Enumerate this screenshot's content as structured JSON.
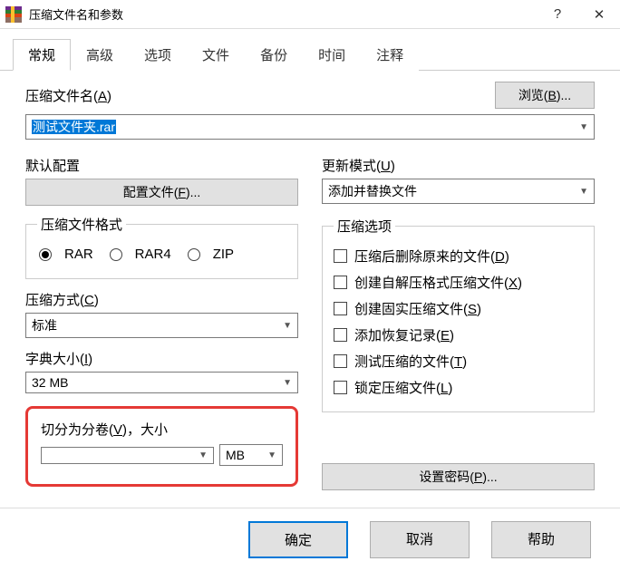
{
  "window": {
    "title": "压缩文件名和参数",
    "help_glyph": "?",
    "close_glyph": "✕"
  },
  "tabs": [
    "常规",
    "高级",
    "选项",
    "文件",
    "备份",
    "时间",
    "注释"
  ],
  "archive_name": {
    "label_pre": "压缩文件名(",
    "label_u": "A",
    "label_post": ")",
    "browse_pre": "浏览(",
    "browse_u": "B",
    "browse_post": ")...",
    "value": "测试文件夹.rar"
  },
  "default_profile": {
    "label": "默认配置",
    "button_pre": "配置文件(",
    "button_u": "F",
    "button_post": ")..."
  },
  "update_mode": {
    "label_pre": "更新模式(",
    "label_u": "U",
    "label_post": ")",
    "value": "添加并替换文件"
  },
  "format": {
    "legend": "压缩文件格式",
    "options": [
      "RAR",
      "RAR4",
      "ZIP"
    ],
    "selected": "RAR"
  },
  "method": {
    "label_pre": "压缩方式(",
    "label_u": "C",
    "label_post": ")",
    "value": "标准"
  },
  "dict": {
    "label_pre": "字典大小(",
    "label_u": "I",
    "label_post": ")",
    "value": "32 MB"
  },
  "split": {
    "label_pre": "切分为分卷(",
    "label_u": "V",
    "label_post": ")，大小",
    "value": "",
    "unit": "MB"
  },
  "options": {
    "legend": "压缩选项",
    "items": [
      {
        "pre": "压缩后删除原来的文件(",
        "u": "D",
        "post": ")"
      },
      {
        "pre": "创建自解压格式压缩文件(",
        "u": "X",
        "post": ")"
      },
      {
        "pre": "创建固实压缩文件(",
        "u": "S",
        "post": ")"
      },
      {
        "pre": "添加恢复记录(",
        "u": "E",
        "post": ")"
      },
      {
        "pre": "测试压缩的文件(",
        "u": "T",
        "post": ")"
      },
      {
        "pre": "锁定压缩文件(",
        "u": "L",
        "post": ")"
      }
    ]
  },
  "password": {
    "label_pre": "设置密码(",
    "label_u": "P",
    "label_post": ")..."
  },
  "footer": {
    "ok": "确定",
    "cancel": "取消",
    "help": "帮助"
  }
}
